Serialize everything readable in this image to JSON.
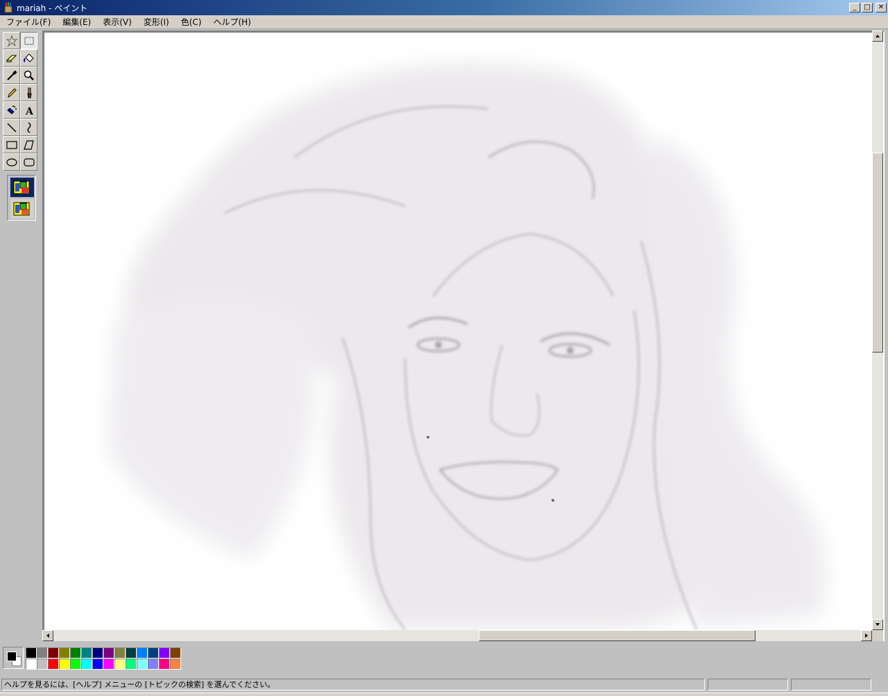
{
  "window": {
    "title": "mariah - ペイント",
    "app_icon": "paint-app-icon",
    "minimize_label": "_",
    "maximize_label": "□",
    "close_label": "✕"
  },
  "menu": {
    "items": [
      {
        "label": "ファイル(F)"
      },
      {
        "label": "編集(E)"
      },
      {
        "label": "表示(V)"
      },
      {
        "label": "変形(I)"
      },
      {
        "label": "色(C)"
      },
      {
        "label": "ヘルプ(H)"
      }
    ]
  },
  "tools": [
    {
      "name": "free-select",
      "icon": "star-select-icon"
    },
    {
      "name": "rect-select",
      "icon": "rect-select-icon"
    },
    {
      "name": "eraser",
      "icon": "eraser-icon"
    },
    {
      "name": "fill",
      "icon": "paint-bucket-icon"
    },
    {
      "name": "pick-color",
      "icon": "eyedropper-icon"
    },
    {
      "name": "magnifier",
      "icon": "magnifier-icon"
    },
    {
      "name": "pencil",
      "icon": "pencil-icon"
    },
    {
      "name": "brush",
      "icon": "brush-icon"
    },
    {
      "name": "airbrush",
      "icon": "airbrush-icon"
    },
    {
      "name": "text",
      "icon": "text-icon"
    },
    {
      "name": "line",
      "icon": "line-icon"
    },
    {
      "name": "curve",
      "icon": "curve-icon"
    },
    {
      "name": "rectangle",
      "icon": "rectangle-icon"
    },
    {
      "name": "polygon",
      "icon": "polygon-icon"
    },
    {
      "name": "ellipse",
      "icon": "ellipse-icon"
    },
    {
      "name": "rounded-rectangle",
      "icon": "rounded-rect-icon"
    }
  ],
  "tool_options": [
    {
      "name": "opaque-option",
      "icon": "opaque-option-icon",
      "selected": true
    },
    {
      "name": "transparent-option",
      "icon": "transparent-option-icon",
      "selected": false
    }
  ],
  "palette": {
    "foreground": "#000000",
    "background": "#ffffff",
    "colors": [
      "#000000",
      "#808080",
      "#800000",
      "#808000",
      "#008000",
      "#008080",
      "#000080",
      "#800080",
      "#808040",
      "#004040",
      "#0080ff",
      "#004080",
      "#8000ff",
      "#804000",
      "#ffffff",
      "#c0c0c0",
      "#ff0000",
      "#ffff00",
      "#00ff00",
      "#00ffff",
      "#0000ff",
      "#ff00ff",
      "#ffff80",
      "#00ff80",
      "#80ffff",
      "#8080ff",
      "#ff0080",
      "#ff8040"
    ]
  },
  "canvas": {
    "image": "pencil-sketch-portrait"
  },
  "scroll": {
    "vertical_fraction": 0.3,
    "horizontal_fraction": 0.52
  },
  "status": {
    "help_text": "ヘルプを見るには、[ヘルプ] メニューの [トピックの検索] を選んでください。",
    "position": "",
    "size": ""
  }
}
